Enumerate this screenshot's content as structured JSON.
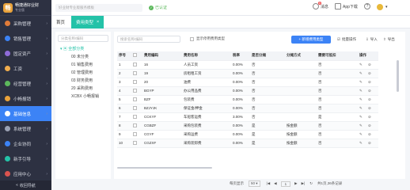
{
  "app": {
    "name": "畅捷通好业财",
    "sub": "专业版"
  },
  "nav": [
    {
      "label": "采购管理",
      "color": "#e07b39"
    },
    {
      "label": "销售管理",
      "color": "#3c83f6"
    },
    {
      "label": "固定资产",
      "color": "#8e6bd8"
    },
    {
      "label": "工资",
      "color": "#f0ad4e"
    },
    {
      "label": "经营管理",
      "color": "#5cb85c"
    },
    {
      "label": "小畅报销",
      "color": "#e9a23b"
    },
    {
      "label": "基础信息",
      "color": "#ffffff",
      "active": true
    },
    {
      "label": "系统管理",
      "color": "#9aa1b3"
    },
    {
      "label": "企业协同",
      "color": "#3c83f6"
    },
    {
      "label": "新手引导",
      "color": "#24c2a8"
    },
    {
      "label": "应用中心",
      "color": "#d9534f"
    }
  ],
  "sidebar_footer": "收回导航",
  "header": {
    "search_placeholder": "好业财专业版服务模板",
    "auth": "已认证",
    "msg": "消息",
    "app": "App下载",
    "help": "?"
  },
  "badge": "6",
  "tabs": {
    "home": "首页",
    "current": "费用类型"
  },
  "tree": {
    "search_placeholder": "分类名称/编码",
    "root": "全部分类",
    "items": [
      "00 未分类",
      "01 销售费用",
      "02 管理费用",
      "03 财务费用",
      "20 采购费用",
      "XCBX 小畅报销"
    ]
  },
  "toolbar": {
    "search_placeholder": "搜索名称/编码",
    "show_disabled": "显示停用费用类型",
    "new": "+ 新增费用类型",
    "batch": "批量操作",
    "import": "导入",
    "export": "导出"
  },
  "table": {
    "headers": [
      "序号",
      "",
      "费用编码",
      "费用名称",
      "税率",
      "是否分摊",
      "分摊方式",
      "需要可抵扣",
      "操作"
    ],
    "rows": [
      [
        "1",
        "",
        "16",
        "人员工资",
        "0.00%",
        "否",
        "",
        "否",
        "✎ ⊘"
      ],
      [
        "2",
        "",
        "19",
        "房租租工资",
        "0.00%",
        "否",
        "",
        "否",
        "✎ ⊘"
      ],
      [
        "3",
        "",
        "20",
        "油费",
        "0.00%",
        "否",
        "",
        "否",
        "✎ ⊘"
      ],
      [
        "4",
        "",
        "BGYP",
        "办公用品费",
        "0.00%",
        "否",
        "",
        "否",
        "✎ ⊘"
      ],
      [
        "5",
        "",
        "BZF",
        "包装费",
        "0.00%",
        "否",
        "",
        "否",
        "✎ ⊘"
      ],
      [
        "6",
        "",
        "BZJYJK",
        "保证金/押金",
        "0.00%",
        "否",
        "",
        "否",
        "✎ ⊘"
      ],
      [
        "7",
        "",
        "CCKYF",
        "车船客运费",
        "3.00%",
        "否",
        "",
        "是",
        "✎ ⊘"
      ],
      [
        "8",
        "",
        "CGBZF",
        "采购包装费",
        "0.00%",
        "是",
        "按金额",
        "否",
        "✎ ⊘"
      ],
      [
        "9",
        "",
        "CGYF",
        "采购运费",
        "0.00%",
        "是",
        "按金额",
        "否",
        "✎ ⊘"
      ],
      [
        "10",
        "",
        "CGZXF",
        "采购装卸费",
        "0.00%",
        "是",
        "按金额",
        "否",
        "✎ ⊘"
      ]
    ]
  },
  "pager": {
    "per_page": "每页显示",
    "size": "50",
    "page": "1",
    "total": "共1页,36条记录"
  }
}
